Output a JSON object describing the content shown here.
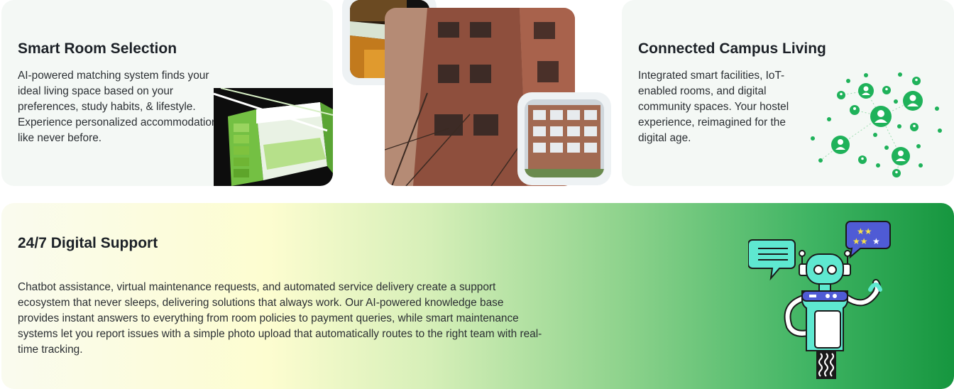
{
  "smart_room": {
    "title": "Smart Room Selection",
    "description": "AI-powered matching system finds your ideal living space based on your preferences, study habits, & lifestyle. Experience personalized accommodation like never before."
  },
  "campus": {
    "title": "Connected Campus Living",
    "description": "Integrated smart facilities, IoT-enabled rooms, and digital community spaces. Your hostel experience, reimagined for the digital age."
  },
  "support": {
    "title": "24/7 Digital Support",
    "description": "Chatbot assistance, virtual maintenance requests, and automated service delivery create a support ecosystem that never sleeps, delivering solutions that always work. Our AI-powered knowledge base provides instant answers to everything from room policies to payment queries, while smart maintenance systems let you report issues with a simple photo upload that automatically routes to the right team with real-time tracking."
  },
  "colors": {
    "card_bg": "#f4f8f5",
    "brand_green": "#16a34a",
    "robot_teal": "#5ee8d0",
    "bubble_blue": "#4f5bd5"
  },
  "icons": [
    "bunk-bed-illustration",
    "network-users-icon",
    "robot-support-illustration",
    "chat-bubble-icon",
    "rating-stars-icon"
  ]
}
